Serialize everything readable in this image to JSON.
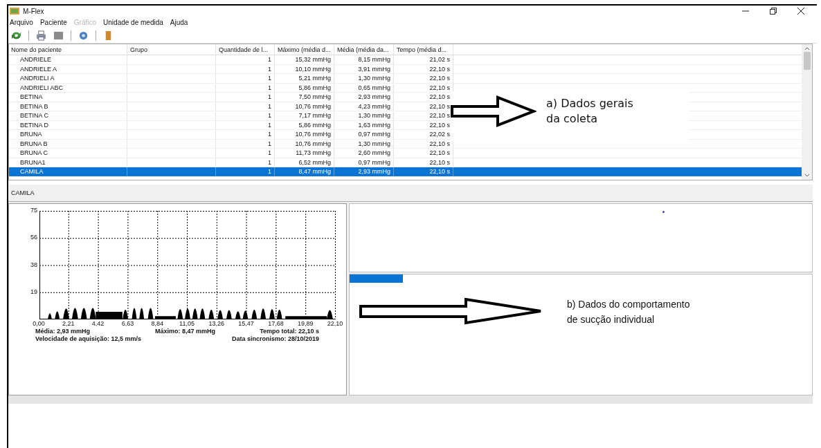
{
  "window": {
    "title": "M-Flex"
  },
  "menu": [
    {
      "label": "Arquivo",
      "disabled": false
    },
    {
      "label": "Paciente",
      "disabled": false
    },
    {
      "label": "Gráfico",
      "disabled": true
    },
    {
      "label": "Unidade de medida",
      "disabled": false
    },
    {
      "label": "Ajuda",
      "disabled": false
    }
  ],
  "toolbar": [
    {
      "kind": "refresh"
    },
    {
      "kind": "separator"
    },
    {
      "kind": "print"
    },
    {
      "kind": "stop"
    },
    {
      "kind": "separator"
    },
    {
      "kind": "help"
    },
    {
      "kind": "separator"
    },
    {
      "kind": "door"
    }
  ],
  "table": {
    "columns": [
      "Nome do paciente",
      "Grupo",
      "Quantidade de l...",
      "Máximo (média d...",
      "Média (média da...",
      "Tempo (média d..."
    ],
    "rows": [
      {
        "cells": [
          "ANDRIELE",
          "",
          "1",
          "15,32 mmHg",
          "8,15 mmHg",
          "21,02 s"
        ],
        "selected": false
      },
      {
        "cells": [
          "ANDRIELE A",
          "",
          "1",
          "10,10 mmHg",
          "3,91 mmHg",
          "22,10 s"
        ],
        "selected": false
      },
      {
        "cells": [
          "ANDRIELI A",
          "",
          "1",
          "5,21 mmHg",
          "1,30 mmHg",
          "22,10 s"
        ],
        "selected": false
      },
      {
        "cells": [
          "ANDRIELI ABC",
          "",
          "1",
          "5,86 mmHg",
          "0,65 mmHg",
          "22,10 s"
        ],
        "selected": false
      },
      {
        "cells": [
          "BETINA",
          "",
          "1",
          "7,50 mmHg",
          "2,93 mmHg",
          "22,10 s"
        ],
        "selected": false
      },
      {
        "cells": [
          "BETINA B",
          "",
          "1",
          "10,76 mmHg",
          "4,23 mmHg",
          "22,10 s"
        ],
        "selected": false
      },
      {
        "cells": [
          "BETINA C",
          "",
          "1",
          "7,17 mmHg",
          "1,30 mmHg",
          "22,10 s"
        ],
        "selected": false
      },
      {
        "cells": [
          "BETINA D",
          "",
          "1",
          "5,86 mmHg",
          "1,63 mmHg",
          "22,10 s"
        ],
        "selected": false
      },
      {
        "cells": [
          "BRUNA",
          "",
          "1",
          "10,76 mmHg",
          "0,97 mmHg",
          "22,02 s"
        ],
        "selected": false
      },
      {
        "cells": [
          "BRUNA B",
          "",
          "1",
          "10,76 mmHg",
          "1,30 mmHg",
          "22,10 s"
        ],
        "selected": false
      },
      {
        "cells": [
          "BRUNA C",
          "",
          "1",
          "11,73 mmHg",
          "2,60 mmHg",
          "22,10 s"
        ],
        "selected": false
      },
      {
        "cells": [
          "BRUNA1",
          "",
          "1",
          "6,52 mmHg",
          "0,97 mmHg",
          "22,10 s"
        ],
        "selected": false
      },
      {
        "cells": [
          "CAMILA",
          "",
          "1",
          "8,47 mmHg",
          "2,93 mmHg",
          "22,10 s"
        ],
        "selected": true
      }
    ]
  },
  "annotation_a": {
    "lines": [
      "a) Dados gerais",
      "da coleta"
    ]
  },
  "patient_panel": {
    "title": "CAMILA",
    "chart": {
      "y_ticks": [
        "75",
        "56",
        "38",
        "19"
      ],
      "x_ticks": [
        "0,00",
        "2,21",
        "4,42",
        "6,63",
        "8,84",
        "11,05",
        "13,26",
        "15,47",
        "17,68",
        "19,89",
        "22,10"
      ],
      "stats": [
        "Média: 2,93 mmHg",
        "Máximo: 8,47 mmHg",
        "Tempo total: 22,10 s",
        "Velocidade de aquisição: 12,5 mm/s",
        "Data sincronismo: 28/10/2019"
      ]
    }
  },
  "progress": {
    "level": 0.115
  },
  "annotation_b": {
    "lines": [
      "b) Dados do comportamento",
      "de sucção individual"
    ]
  }
}
